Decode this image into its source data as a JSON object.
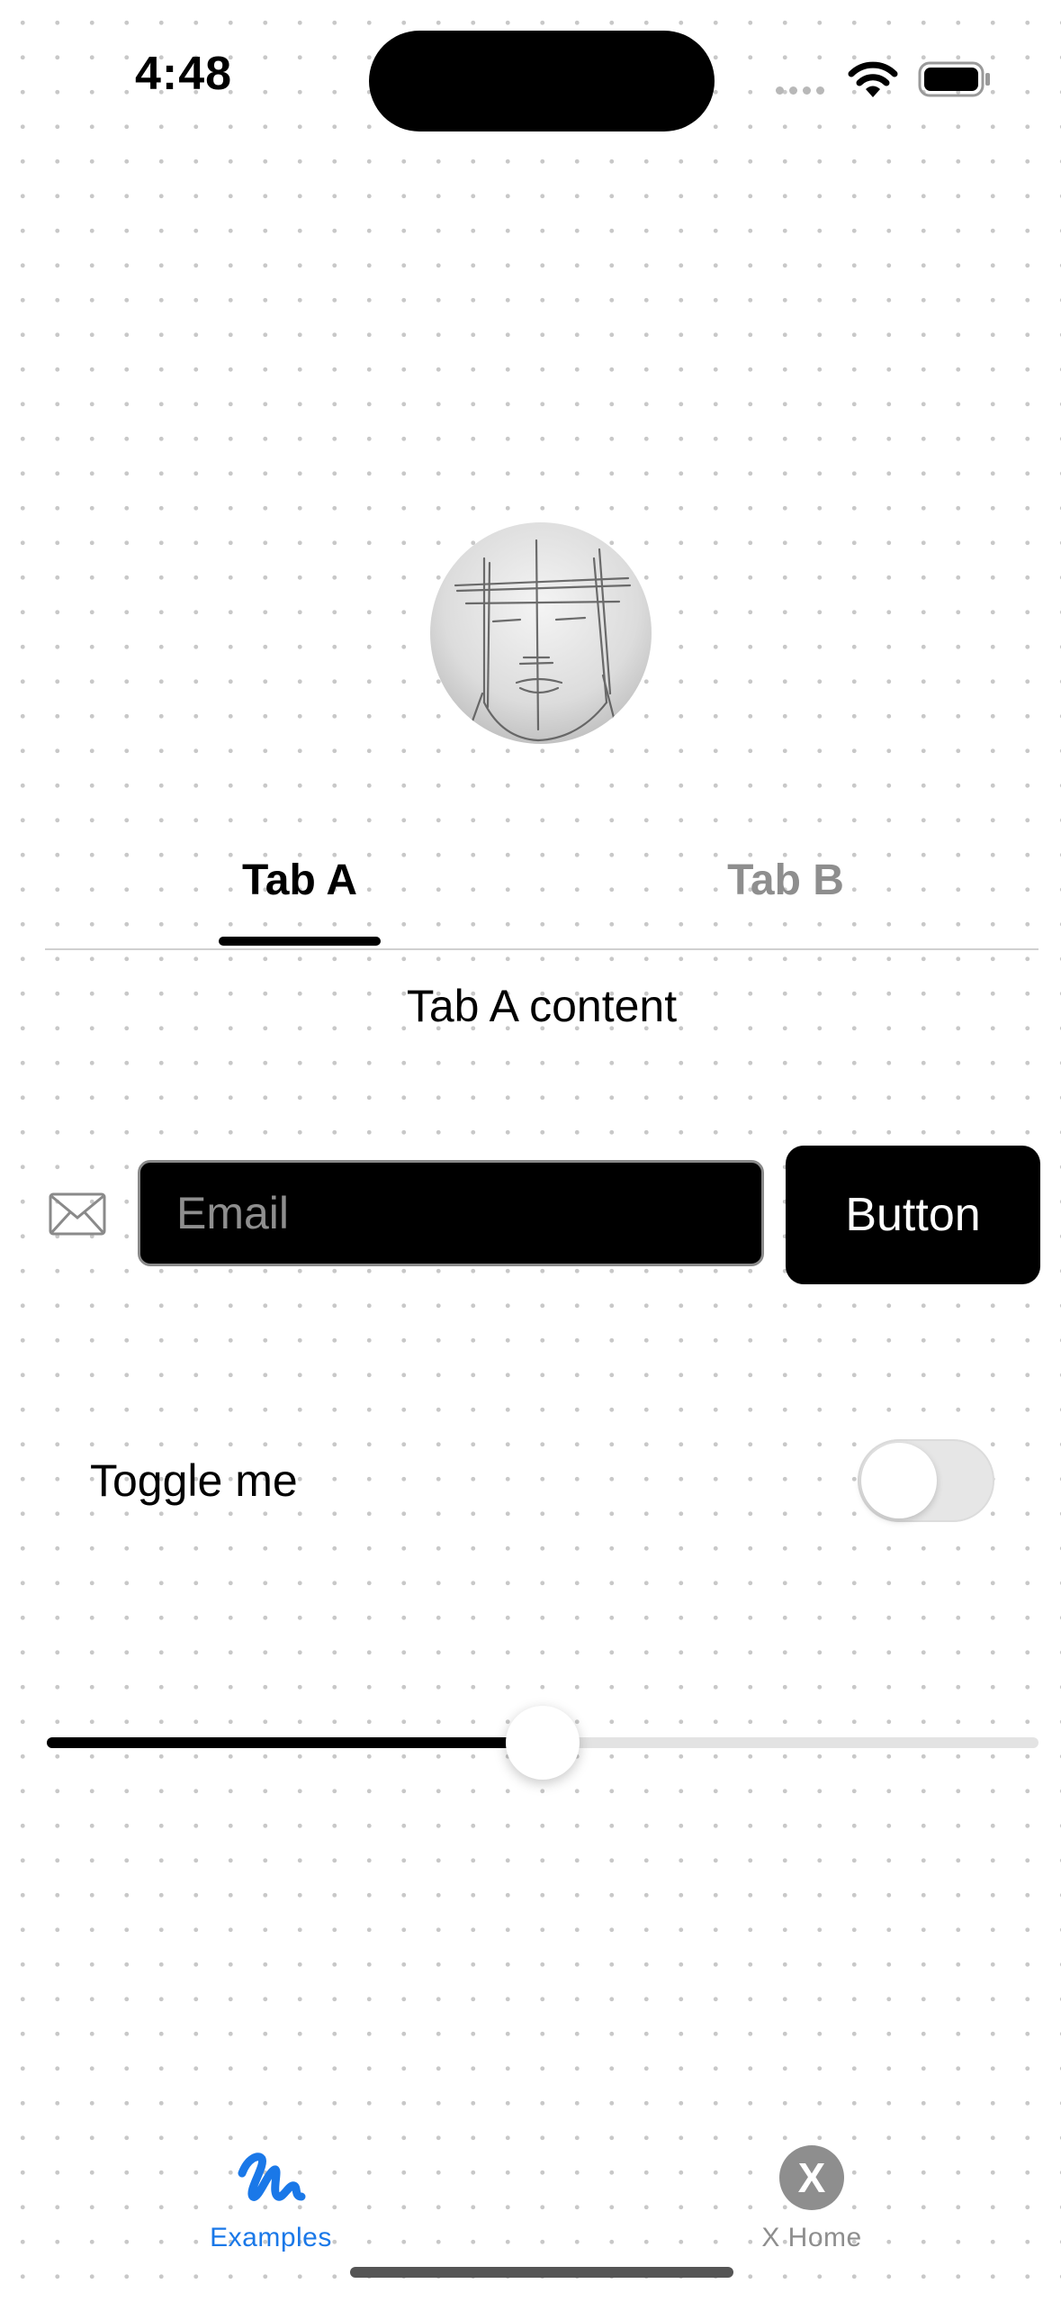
{
  "status_bar": {
    "time": "4:48",
    "icons": [
      "cellular-signal-icon",
      "wifi-icon",
      "battery-icon"
    ]
  },
  "profile": {
    "avatar": "pencil-sketch-face-avatar"
  },
  "tabs": {
    "items": [
      {
        "label": "Tab A",
        "selected": true
      },
      {
        "label": "Tab B",
        "selected": false
      }
    ],
    "content": "Tab A content"
  },
  "email_row": {
    "icon": "mail-icon",
    "placeholder": "Email",
    "value": "",
    "button_label": "Button"
  },
  "toggle": {
    "label": "Toggle me",
    "on": false
  },
  "slider": {
    "value": 0.5
  },
  "bottom_nav": {
    "items": [
      {
        "label": "Examples",
        "icon": "scribble-icon",
        "active": true
      },
      {
        "label": "X Home",
        "icon": "x-circle-icon",
        "active": false
      }
    ]
  },
  "colors": {
    "accent": "#1a78e8",
    "inactive": "#8e8e8e",
    "primary": "#000000",
    "background": "#ffffff"
  }
}
